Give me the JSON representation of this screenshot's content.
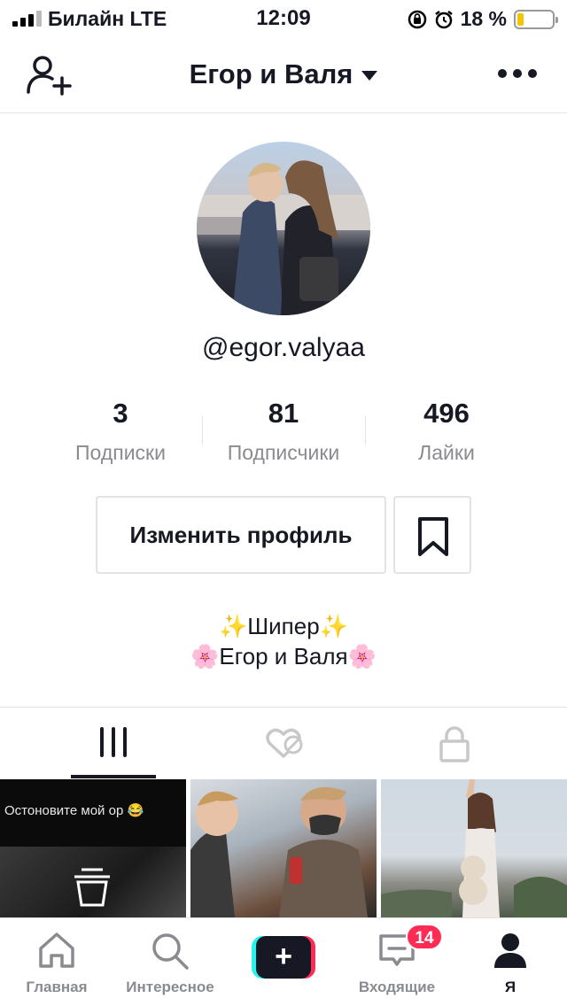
{
  "status_bar": {
    "carrier": "Билайн  LTE",
    "time": "12:09",
    "battery": "18 %",
    "battery_level": 0.18,
    "battery_color": "#f5c400"
  },
  "header": {
    "title": "Егор и Валя",
    "add_user_icon": "add-user-icon",
    "more_icon": "more-icon"
  },
  "profile": {
    "username": "@egor.valyaa",
    "stats": [
      {
        "value": "3",
        "label": "Подписки"
      },
      {
        "value": "81",
        "label": "Подписчики"
      },
      {
        "value": "496",
        "label": "Лайки"
      }
    ],
    "edit_button": "Изменить профиль",
    "bio_line1": "✨Шипер✨",
    "bio_line2": "🌸Егор и Валя🌸"
  },
  "tabs": [
    {
      "icon": "videos-grid-icon",
      "active": true
    },
    {
      "icon": "liked-videos-icon",
      "active": false
    },
    {
      "icon": "private-lock-icon",
      "active": false
    }
  ],
  "videos": [
    {
      "caption": "Остоновите мой ор 😂"
    },
    {
      "caption": ""
    },
    {
      "caption": ""
    }
  ],
  "bottom_nav": {
    "items": [
      {
        "label": "Главная",
        "icon": "home-icon"
      },
      {
        "label": "Интересное",
        "icon": "search-icon"
      },
      {
        "label": "",
        "icon": "create-plus-icon"
      },
      {
        "label": "Входящие",
        "icon": "inbox-icon"
      },
      {
        "label": "Я",
        "icon": "profile-icon"
      }
    ],
    "inbox_badge": "14"
  },
  "colors": {
    "accent": "#fe2c55",
    "cyan": "#25f4ee",
    "text": "#161823",
    "muted": "#8a8b91"
  }
}
